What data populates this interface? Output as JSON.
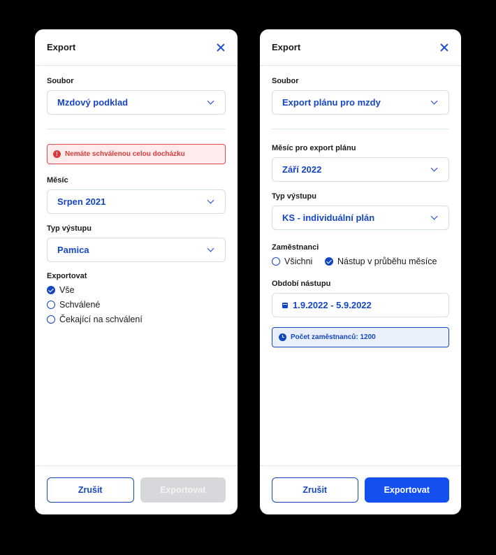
{
  "left": {
    "title": "Export",
    "soubor_label": "Soubor",
    "soubor_value": "Mzdový podklad",
    "alert_text": "Nemáte schválenou celou docházku",
    "mesic_label": "Měsíc",
    "mesic_value": "Srpen 2021",
    "typ_label": "Typ výstupu",
    "typ_value": "Pamica",
    "exportovat_label": "Exportovat",
    "options": [
      "Vše",
      "Schválené",
      "Čekající na schválení"
    ],
    "selected_option": "Vše",
    "cancel_label": "Zrušit",
    "export_label": "Exportovat"
  },
  "right": {
    "title": "Export",
    "soubor_label": "Soubor",
    "soubor_value": "Export plánu pro mzdy",
    "mesic_label": "Měsíc pro export plánu",
    "mesic_value": "Září 2022",
    "typ_label": "Typ výstupu",
    "typ_value": "KS - individuální plán",
    "zamestnanci_label": "Zaměstnanci",
    "zamestnanci_options": [
      "Všichni",
      "Nástup v průběhu měsíce"
    ],
    "zamestnanci_selected": "Nástup v průběhu měsíce",
    "obdobi_label": "Období nástupu",
    "obdobi_value": "1.9.2022 - 5.9.2022",
    "info_text": "Počet zaměstnanců: 1200",
    "cancel_label": "Zrušit",
    "export_label": "Exportovat"
  },
  "colors": {
    "accent": "#1446c4",
    "primary_button": "#1450f0",
    "error": "#d93b3d",
    "disabled": "#d7d8db"
  }
}
